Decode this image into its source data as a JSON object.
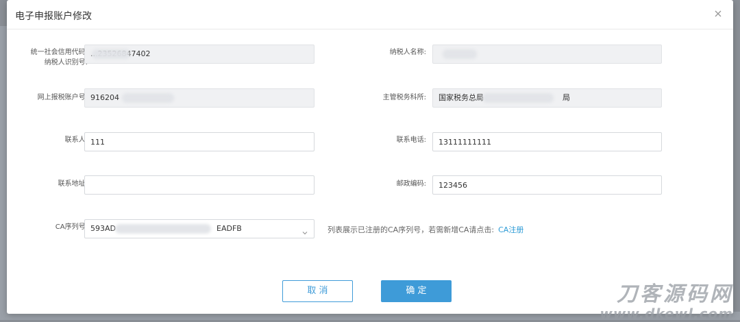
{
  "modal": {
    "title": "电子申报账户修改",
    "close_icon": "close-icon"
  },
  "fields": {
    "credit_code": {
      "label_line1": "统一社会信用代码/",
      "label_line2": "纳税人识别号:",
      "value": "...23526847402"
    },
    "taxpayer_name": {
      "label": "纳税人名称:",
      "value": ""
    },
    "online_account": {
      "label": "网上报税账户号:",
      "value": "916204"
    },
    "tax_office": {
      "label": "主管税务科所:",
      "value_prefix": "国家税务总局",
      "value_suffix": "局"
    },
    "contact": {
      "label": "联系人:",
      "value": "111"
    },
    "phone": {
      "label": "联系电话:",
      "value": "13111111111"
    },
    "address": {
      "label": "联系地址:",
      "value": ""
    },
    "postcode": {
      "label": "邮政编码:",
      "value": "123456"
    },
    "ca_serial": {
      "label": "CA序列号:",
      "value_prefix": "593AD",
      "value_suffix": "EADFB",
      "arrow_icon": "chevron-down-icon"
    }
  },
  "hint": {
    "text": "列表展示已注册的CA序列号，若需新增CA请点击:",
    "link": "CA注册",
    "link_color": "#2d9bd6"
  },
  "buttons": {
    "cancel": "取 消",
    "confirm": "确 定",
    "accent": "#3e9bd8"
  },
  "watermark": {
    "cn": "刀客源码网",
    "url": "www.dkewl.com"
  }
}
